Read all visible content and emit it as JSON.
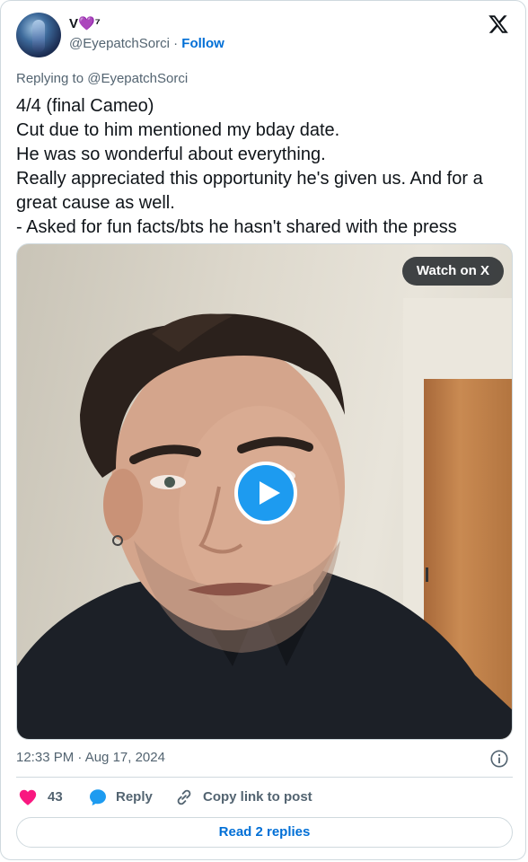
{
  "user": {
    "display_name": "V💜⁷",
    "handle": "@EyepatchSorci",
    "separator": "·",
    "follow_label": "Follow",
    "avatar_icon": "avatar-image"
  },
  "brand_icon": "x-logo-icon",
  "reply_to": "Replying to @EyepatchSorci",
  "tweet_text": "4/4 (final Cameo)\nCut due to him mentioned my bday date.\nHe was so wonderful about everything.\nReally appreciated this opportunity he's given us. And for a great cause as well.\n- Asked for fun facts/bts he hasn't shared with the press",
  "media": {
    "watch_label": "Watch on X",
    "play_icon": "play-icon"
  },
  "timestamp": "12:33 PM · Aug 17, 2024",
  "actions": {
    "like_count": "43",
    "reply_label": "Reply",
    "copy_label": "Copy link to post"
  },
  "read_replies_label": "Read 2 replies",
  "colors": {
    "link": "#006fd6",
    "accent": "#1d9bf0",
    "heart": "#f91880",
    "muted": "#536471",
    "border": "#cfd9de"
  }
}
